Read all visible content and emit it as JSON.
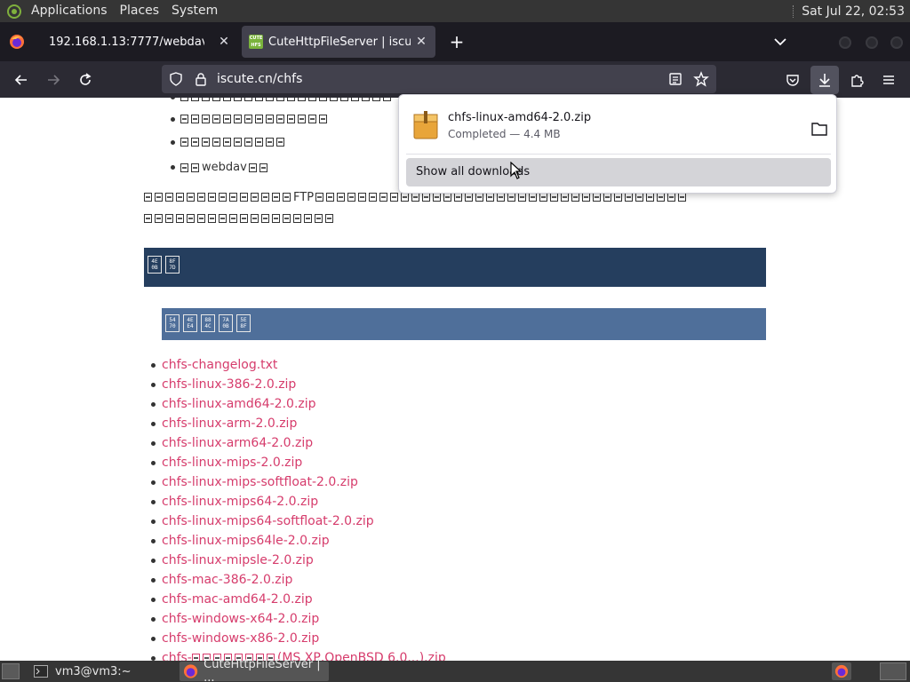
{
  "top_panel": {
    "menus": [
      "Applications",
      "Places",
      "System"
    ],
    "clock": "Sat Jul 22, 02:53"
  },
  "tabs": [
    {
      "title": "192.168.1.13:7777/webdav"
    },
    {
      "title": "CuteHttpFileServer | iscute.cn",
      "favicon_text": "CUTE HFS"
    }
  ],
  "navbar": {
    "url": "iscute.cn/chfs"
  },
  "page": {
    "bullets": [
      "webdav"
    ],
    "para_inline": "FTP",
    "files": [
      "chfs-changelog.txt",
      "chfs-linux-386-2.0.zip",
      "chfs-linux-amd64-2.0.zip",
      "chfs-linux-arm-2.0.zip",
      "chfs-linux-arm64-2.0.zip",
      "chfs-linux-mips-2.0.zip",
      "chfs-linux-mips-softfloat-2.0.zip",
      "chfs-linux-mips64-2.0.zip",
      "chfs-linux-mips64-softfloat-2.0.zip",
      "chfs-linux-mips64le-2.0.zip",
      "chfs-linux-mipsle-2.0.zip",
      "chfs-mac-386-2.0.zip",
      "chfs-mac-amd64-2.0.zip",
      "chfs-windows-x64-2.0.zip",
      "chfs-windows-x86-2.0.zip"
    ],
    "last_file_prefix": "chfs-",
    "last_file_suffix": "(MS XP,OpenBSD 6.0...).zip",
    "header_dark_codes": [
      "4E 0B",
      "8F 7D"
    ],
    "header_blue_codes": [
      "54 70",
      "4E E4",
      "88 4C",
      "7A 0B",
      "5E 8F"
    ]
  },
  "downloads": {
    "filename": "chfs-linux-amd64-2.0.zip",
    "status": "Completed — 4.4 MB",
    "show_all_label": "Show all downloads"
  },
  "taskbar": {
    "tasks": [
      "vm3@vm3:~",
      "CuteHttpFileServer | ..."
    ]
  },
  "colors": {
    "link": "#d63c6c",
    "header_dark": "#253e5e",
    "header_blue": "#4f6f9a",
    "toolbar": "#2b2a33",
    "tabstrip": "#1c1b22"
  }
}
